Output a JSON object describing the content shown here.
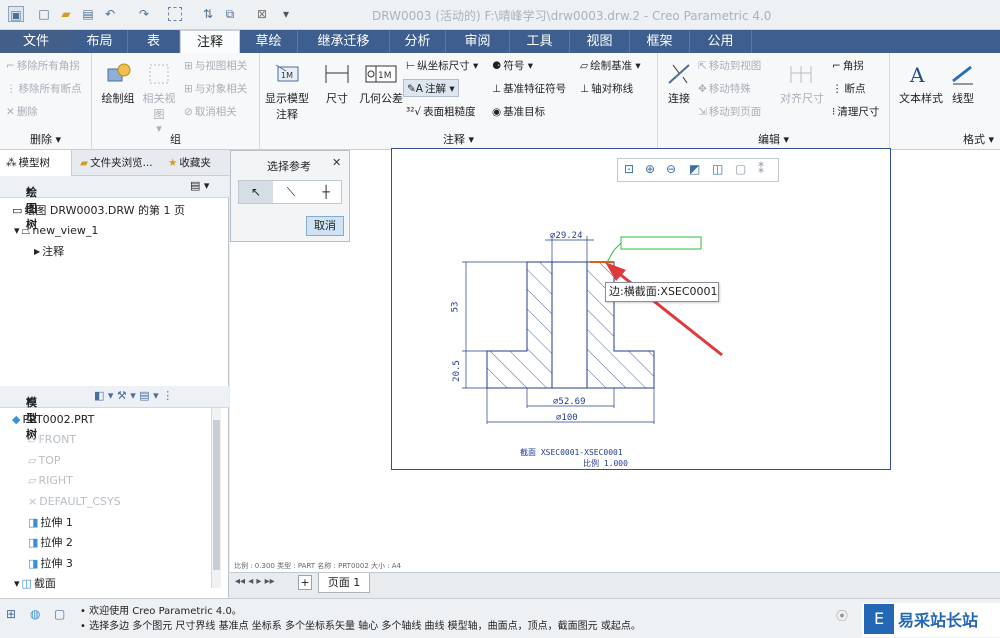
{
  "window": {
    "title": "DRW0003 (活动的) F:\\晴峰学习\\drw0003.drw.2 - Creo Parametric 4.0"
  },
  "tabs": [
    {
      "label": "文件"
    },
    {
      "label": "布局"
    },
    {
      "label": "表"
    },
    {
      "label": "注释"
    },
    {
      "label": "草绘"
    },
    {
      "label": "继承迁移"
    },
    {
      "label": "分析"
    },
    {
      "label": "审阅"
    },
    {
      "label": "工具"
    },
    {
      "label": "视图"
    },
    {
      "label": "框架"
    },
    {
      "label": "公用"
    }
  ],
  "ribbon": {
    "delete_group": {
      "label": "删除",
      "items": [
        "移除所有角拐",
        "移除所有断点",
        "删除"
      ]
    },
    "group_group": {
      "label": "组",
      "draw_group": "绘制组",
      "related_view": "相关视图",
      "items": [
        "与视图相关",
        "与对象相关",
        "取消相关"
      ]
    },
    "annotate_group": {
      "label": "注释",
      "show_model": "显示模型注释",
      "dimension": "尺寸",
      "geom_tol": "几何公差",
      "items_col1": [
        "纵坐标尺寸",
        "注解",
        "表面粗糙度"
      ],
      "items_col2": [
        "符号",
        "基准特征符号",
        "基准目标"
      ],
      "items_col3": [
        "绘制基准",
        "轴对称线"
      ]
    },
    "edit_group": {
      "label": "编辑",
      "connect": "连接",
      "items": [
        "移动到视图",
        "移动特殊",
        "移动到页面"
      ],
      "align": "对齐尺寸",
      "items2": [
        "角拐",
        "断点",
        "清理尺寸"
      ]
    },
    "format_group": {
      "label": "格式",
      "text_style": "文本样式",
      "line_style": "线型"
    }
  },
  "left_panel": {
    "tabs": [
      "模型树",
      "文件夹浏览...",
      "收藏夹"
    ],
    "drawing_tree": {
      "header": "绘图树",
      "items": [
        "绘图 DRW0003.DRW 的第 1 页",
        "new_view_1",
        "注释"
      ]
    },
    "model_tree": {
      "header": "模型树",
      "items": [
        "PRT0002.PRT",
        "FRONT",
        "TOP",
        "RIGHT",
        "DEFAULT_CSYS",
        "拉伸 1",
        "拉伸 2",
        "拉伸 3",
        "截面"
      ]
    }
  },
  "dialog": {
    "title": "选择参考",
    "cancel": "取消"
  },
  "drawing": {
    "dim_top": "⌀29.24",
    "dim_mid": "⌀52.69",
    "dim_bottom": "⌀100",
    "dim_height": "53",
    "dim_base": "20.5",
    "tooltip": "边:横截面:XSEC0001",
    "section_label": "截面 XSEC0001-XSEC0001",
    "scale_label": "比例 1.000"
  },
  "bottom_strip": "比例 : 0.300   类型 : PART   名称 : PRT0002   大小 : A4",
  "pagebar": {
    "page": "页面 1"
  },
  "status": {
    "line1": "• 欢迎使用 Creo Parametric 4.0。",
    "line2": "• 选择多边 多个图元 尺寸界线 基准点 坐标系 多个坐标系矢量 轴心 多个轴线 曲线 模型轴，曲面点，顶点，截面图元 或起点。"
  },
  "watermark": "易采站长站",
  "colors": {
    "tab_bg": "#3d5e8f",
    "sheet_border": "#364c9b",
    "highlight": "#e85b14",
    "arrow": "#e0393b",
    "green_note": "#2fbf36"
  }
}
